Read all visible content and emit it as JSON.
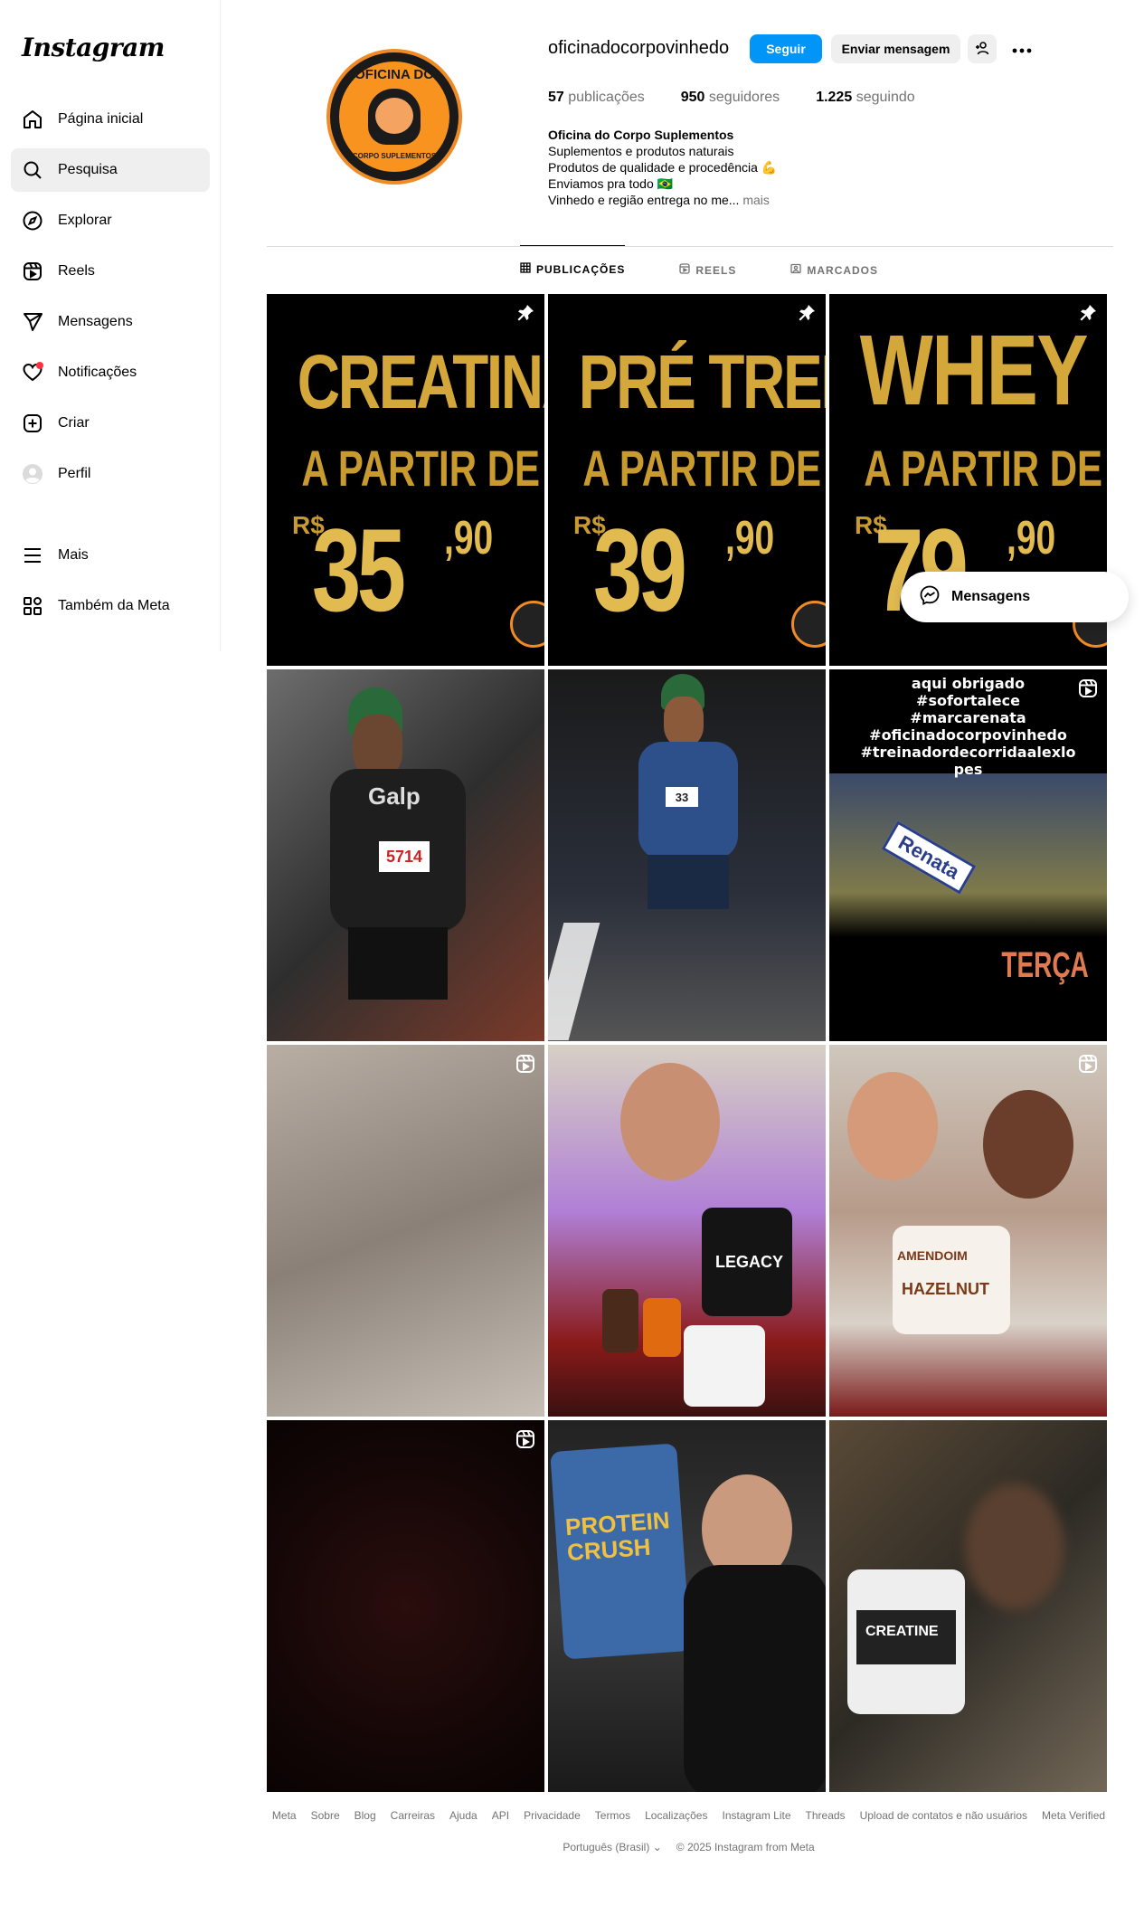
{
  "app": {
    "logo_text": "Instagram"
  },
  "sidebar": {
    "items": [
      {
        "label": "Página inicial",
        "icon": "home-icon"
      },
      {
        "label": "Pesquisa",
        "icon": "search-icon"
      },
      {
        "label": "Explorar",
        "icon": "compass-icon"
      },
      {
        "label": "Reels",
        "icon": "reels-icon"
      },
      {
        "label": "Mensagens",
        "icon": "send-icon"
      },
      {
        "label": "Notificações",
        "icon": "heart-icon"
      },
      {
        "label": "Criar",
        "icon": "plus-square-icon"
      },
      {
        "label": "Perfil",
        "icon": "profile-avatar-icon"
      }
    ],
    "bottom": [
      {
        "label": "Mais",
        "icon": "menu-icon"
      },
      {
        "label": "Também da Meta",
        "icon": "meta-apps-icon"
      }
    ],
    "active_index": 1
  },
  "profile": {
    "username": "oficinadocorpovinhedo",
    "avatar_top": "OFICINA DO",
    "avatar_bottom": "CORPO SUPLEMENTOS",
    "follow_label": "Seguir",
    "message_label": "Enviar mensagem",
    "stats": {
      "posts_count": "57",
      "posts_label": "publicações",
      "followers_count": "950",
      "followers_label": "seguidores",
      "following_count": "1.225",
      "following_label": "seguindo"
    },
    "bio": {
      "name": "Oficina do Corpo Suplementos",
      "line1": "Suplementos e produtos naturais",
      "line2": "Produtos de qualidade e procedência 💪",
      "line3": "Enviamos pra todo 🇧🇷",
      "line4": "Vinhedo e região entrega no me...",
      "more": "mais"
    }
  },
  "tabs": [
    {
      "label": "PUBLICAÇÕES",
      "icon": "grid-icon"
    },
    {
      "label": "REELS",
      "icon": "reels-icon"
    },
    {
      "label": "MARCADOS",
      "icon": "tagged-icon"
    }
  ],
  "posts": {
    "promo1": {
      "line1": "CREATINA",
      "line2": "A PARTIR DE",
      "currency": "R$",
      "price": "35",
      "cents": ",90"
    },
    "promo2": {
      "line1": "PRÉ TREINO",
      "line2": "A PARTIR DE",
      "currency": "R$",
      "price": "39",
      "cents": ",90"
    },
    "promo3": {
      "line1": "WHEY",
      "line2": "A PARTIR DE",
      "currency": "R$",
      "price": "79",
      "cents": ",90"
    },
    "runner1_brand": "Galp",
    "runner1_bib": "5714",
    "runner2_bib": "33",
    "reel_text": "aqui obrigado\n#sofortalece\n#marcarenata\n#oficinadocorpovinhedo\n#treinadordecorridaalexlo\npes",
    "reel_patch": "Renata",
    "reel_day": "TERÇA",
    "product_legacy": "LEGACY",
    "product_amendo": "AMENDOIM",
    "product_hazelnut": "HAZELNUT",
    "product_protein": "PROTEIN CRUSH",
    "product_creatine": "CREATINE"
  },
  "floating_messages": {
    "label": "Mensagens"
  },
  "footer": {
    "links": [
      "Meta",
      "Sobre",
      "Blog",
      "Carreiras",
      "Ajuda",
      "API",
      "Privacidade",
      "Termos",
      "Localizações",
      "Instagram Lite",
      "Threads",
      "Upload de contatos e não usuários",
      "Meta Verified"
    ],
    "language": "Português (Brasil)",
    "copyright": "© 2025 Instagram from Meta"
  },
  "colors": {
    "accent": "#0095f6",
    "gold": "#d4a73a",
    "notification": "#ff3040",
    "brand_orange": "#f08a24"
  }
}
